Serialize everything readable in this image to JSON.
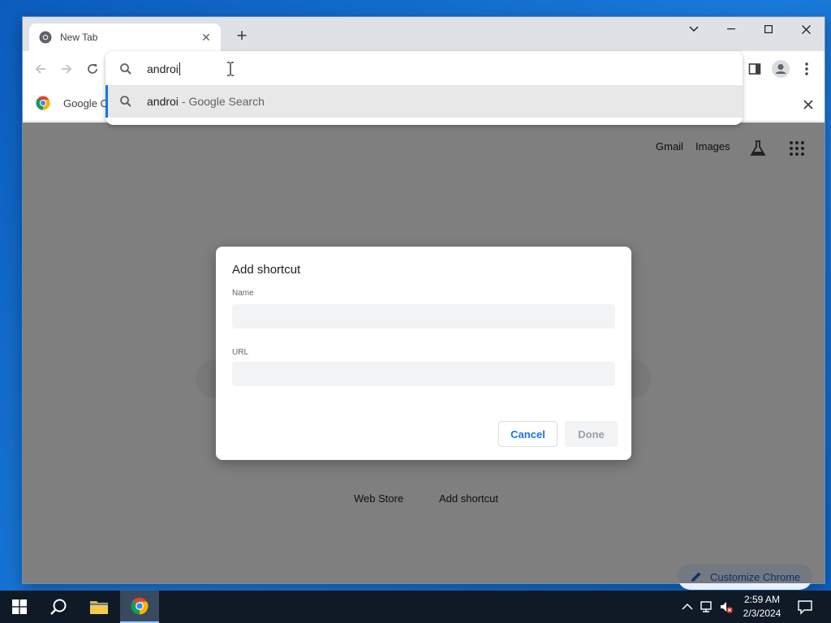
{
  "browser": {
    "tab_title": "New Tab",
    "new_tab_symbol": "+",
    "tab_close_symbol": "✕"
  },
  "omnibox": {
    "input_value": "androi",
    "suggestion_query": "androi",
    "suggestion_suffix": "- Google Search"
  },
  "bookmarks": {
    "item_label": "Google C"
  },
  "page": {
    "gmail": "Gmail",
    "images": "Images",
    "shortcuts": [
      "Web Store",
      "Add shortcut"
    ],
    "customize": "Customize Chrome"
  },
  "dialog": {
    "title": "Add shortcut",
    "name_label": "Name",
    "url_label": "URL",
    "name_value": "",
    "url_value": "",
    "cancel": "Cancel",
    "done": "Done"
  },
  "taskbar": {
    "time": "2:59 AM",
    "date": "2/3/2024"
  },
  "colors": {
    "accent": "#1a73e8",
    "taskbar": "#101a26"
  }
}
